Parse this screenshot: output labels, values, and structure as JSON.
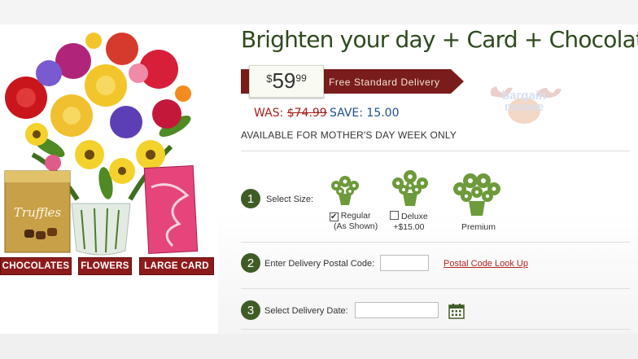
{
  "product": {
    "title": "Brighten your day + Card + Chocolates",
    "price": {
      "currency": "$",
      "dollars": "59",
      "cents": "99"
    },
    "delivery_banner": "Free Standard Delivery",
    "was_label": "WAS:",
    "was_price": "$74.99",
    "save_label": "SAVE: 15.00",
    "availability": "AVAILABLE FOR MOTHER'S DAY WEEK ONLY",
    "image_chocolate_box_text": "Truffles"
  },
  "image_buttons": [
    {
      "label": "CHOCOLATES"
    },
    {
      "label": "FLOWERS"
    },
    {
      "label": "LARGE CARD"
    }
  ],
  "watermark": {
    "line1": "bargain",
    "line2": "moose"
  },
  "steps": {
    "size": {
      "number": "1",
      "label": "Select Size:",
      "options": [
        {
          "name": "Regular",
          "detail": "(As Shown)",
          "checked": true
        },
        {
          "name": "Deluxe",
          "detail": "+$15.00",
          "checked": false
        },
        {
          "name": "Premium",
          "detail": "",
          "checked": false
        }
      ]
    },
    "postal": {
      "number": "2",
      "label": "Enter Delivery Postal Code:",
      "value": "",
      "lookup_link": "Postal Code Look Up"
    },
    "date": {
      "number": "3",
      "label": "Select Delivery Date:",
      "value": "",
      "calendar_icon": "calendar-icon"
    }
  },
  "colors": {
    "title_green": "#2f4a1e",
    "ribbon_red": "#7a1c1c",
    "button_red": "#8e1b1b",
    "was_red": "#a41e1e",
    "save_blue": "#1e4e8a",
    "step_green": "#3f5c26",
    "icon_green": "#6d9a3a"
  }
}
